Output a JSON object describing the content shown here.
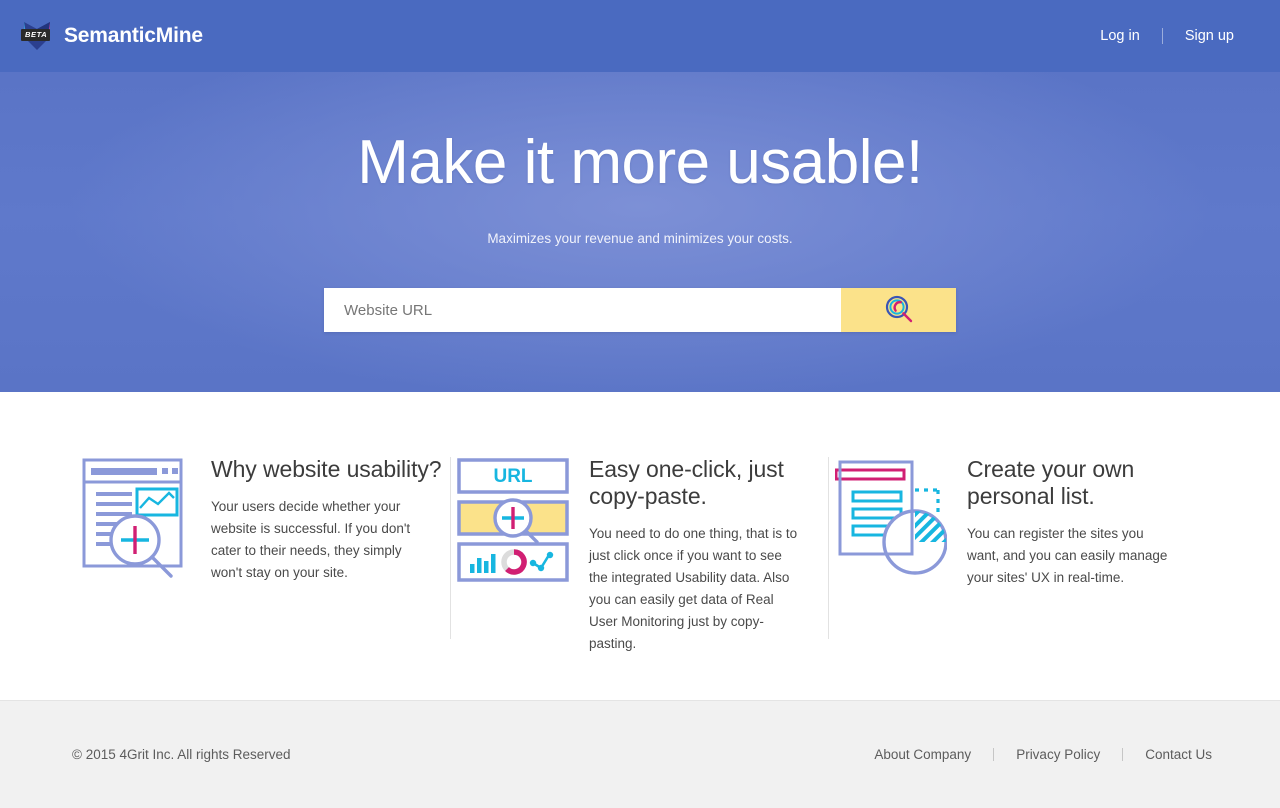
{
  "header": {
    "brand_name": "SemanticMine",
    "beta_badge": "BETA",
    "logo_icon": "star-burst-logo-icon",
    "login_label": "Log in",
    "signup_label": "Sign up"
  },
  "hero": {
    "title": "Make it more usable!",
    "subtitle": "Maximizes your revenue and minimizes your costs.",
    "search": {
      "placeholder": "Website URL",
      "value": "",
      "button_icon": "magnifier-search-icon"
    }
  },
  "features": [
    {
      "icon": "browser-window-magnifier-icon",
      "title": "Why website usability?",
      "text": "Your users decide whether your website is successful. If you don't cater to their needs, they simply won't stay on your site."
    },
    {
      "icon": "url-bar-charts-icon",
      "label_url": "URL",
      "title": "Easy one-click, just copy-paste.",
      "text": "You need to do one thing, that is to just click once if you want to see the integrated Usability data. Also you can easily get data of Real User Monitoring just by copy-pasting."
    },
    {
      "icon": "document-list-circle-icon",
      "title": "Create your own personal list.",
      "text": "You can register the sites you want, and you can easily manage your sites' UX in real-time."
    }
  ],
  "footer": {
    "copyright": "© 2015 4Grit Inc. All rights Reserved",
    "links": [
      {
        "label": "About Company"
      },
      {
        "label": "Privacy Policy"
      },
      {
        "label": "Contact Us"
      }
    ]
  },
  "colors": {
    "header_bg": "#4a6ac0",
    "hero_bg": "#5d77c9",
    "accent_yellow": "#fbe28a",
    "accent_cyan": "#17b6e0",
    "accent_magenta": "#d11f73",
    "accent_purple": "#7e8ed4",
    "footer_bg": "#f1f1f1"
  }
}
